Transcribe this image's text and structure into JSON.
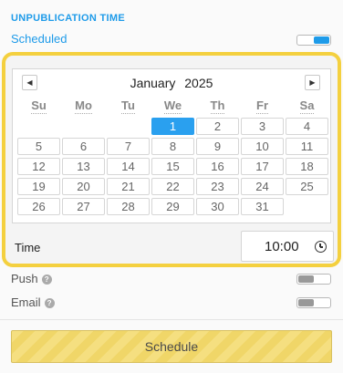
{
  "section": {
    "title": "UNPUBLICATION TIME"
  },
  "scheduled": {
    "label": "Scheduled",
    "enabled": true
  },
  "calendar": {
    "month": "January",
    "year": "2025",
    "prev_icon": "triangle-left-icon",
    "next_icon": "triangle-right-icon",
    "weekdays": [
      "Su",
      "Mo",
      "Tu",
      "We",
      "Th",
      "Fr",
      "Sa"
    ],
    "selected_day": "1",
    "days": [
      "1",
      "2",
      "3",
      "4",
      "5",
      "6",
      "7",
      "8",
      "9",
      "10",
      "11",
      "12",
      "13",
      "14",
      "15",
      "16",
      "17",
      "18",
      "19",
      "20",
      "21",
      "22",
      "23",
      "24",
      "25",
      "26",
      "27",
      "28",
      "29",
      "30",
      "31"
    ]
  },
  "time": {
    "label": "Time",
    "value": "10:00",
    "icon": "clock-icon"
  },
  "options": {
    "push": {
      "label": "Push",
      "help": "?",
      "enabled": false
    },
    "email": {
      "label": "Email",
      "help": "?",
      "enabled": false
    }
  },
  "actions": {
    "schedule_label": "Schedule"
  },
  "colors": {
    "accent": "#1e9be9",
    "highlight_border": "#f4d03f",
    "button": "#f5df80"
  }
}
